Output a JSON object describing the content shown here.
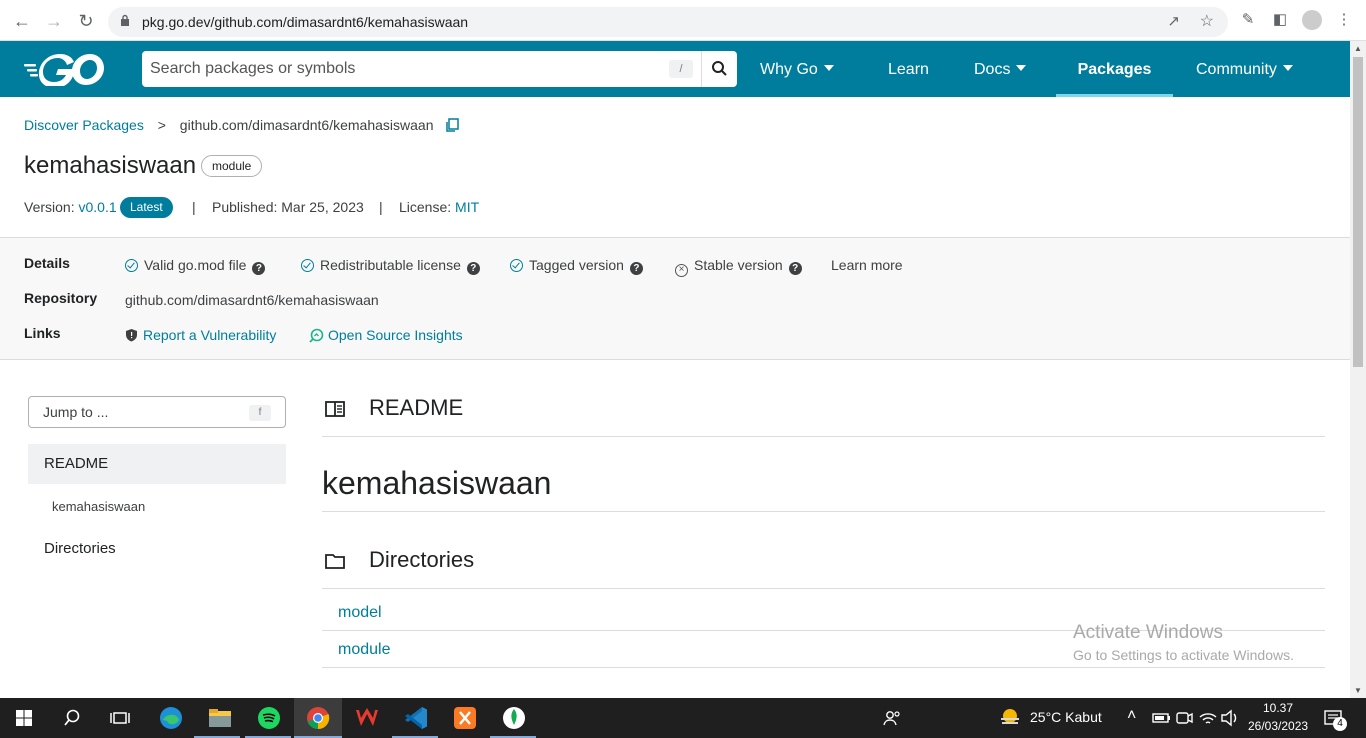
{
  "browser": {
    "url": "pkg.go.dev/github.com/dimasardnt6/kemahasiswaan"
  },
  "header": {
    "search_placeholder": "Search packages or symbols",
    "search_shortcut": "/",
    "nav": {
      "why_go": "Why Go",
      "learn": "Learn",
      "docs": "Docs",
      "packages": "Packages",
      "community": "Community"
    }
  },
  "crumbs": {
    "discover": "Discover Packages",
    "sep": ">",
    "path": "github.com/dimasardnt6/kemahasiswaan"
  },
  "package": {
    "title": "kemahasiswaan",
    "kind_badge": "module",
    "version_label": "Version:",
    "version": "v0.0.1",
    "latest_badge": "Latest",
    "published_label": "Published: Mar 25, 2023",
    "license_label": "License:",
    "license": "MIT",
    "divider": "|"
  },
  "details": {
    "details_label": "Details",
    "repository_label": "Repository",
    "links_label": "Links",
    "valid_gomod": "Valid go.mod file",
    "redistributable": "Redistributable license",
    "tagged": "Tagged version",
    "stable": "Stable version",
    "learn_more": "Learn more",
    "repository": "github.com/dimasardnt6/kemahasiswaan",
    "report_vuln": "Report a Vulnerability",
    "open_source_insights": "Open Source Insights"
  },
  "sidebar": {
    "jump_placeholder": "Jump to ...",
    "jump_shortcut": "f",
    "readme": "README",
    "readme_sub": "kemahasiswaan",
    "directories": "Directories"
  },
  "main": {
    "readme_title": "README",
    "readme_h1": "kemahasiswaan",
    "directories_title": "Directories",
    "directories": [
      "model",
      "module"
    ]
  },
  "watermark": {
    "line1": "Activate Windows",
    "line2": "Go to Settings to activate Windows."
  },
  "taskbar": {
    "weather": "25°C  Kabut",
    "time": "10.37",
    "date": "26/03/2023",
    "notifications": "4"
  },
  "colors": {
    "go_blue": "#007d9c",
    "link": "#007d9c"
  }
}
